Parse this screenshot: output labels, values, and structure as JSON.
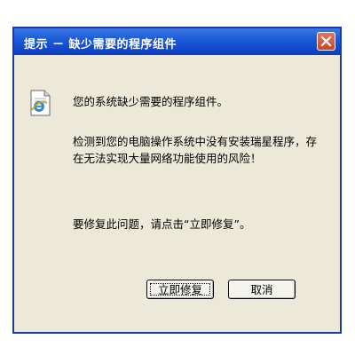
{
  "window": {
    "title": "提示 － 缺少需要的程序组件"
  },
  "message": {
    "line1": "您的系统缺少需要的程序组件。",
    "line2": "检测到您的电脑操作系统中没有安装瑞星程序，存在无法实现大量网络功能使用的风险！",
    "line3": "要修复此问题，请点击“立即修复”。"
  },
  "buttons": {
    "fix_label": "立即修复",
    "cancel_label": "取消"
  },
  "icons": {
    "close": "close-icon",
    "app": "ie-document-icon"
  },
  "colors": {
    "titlebar": "#0a3dbf",
    "close_button": "#c8452a",
    "dialog_bg": "#ece9d8"
  }
}
